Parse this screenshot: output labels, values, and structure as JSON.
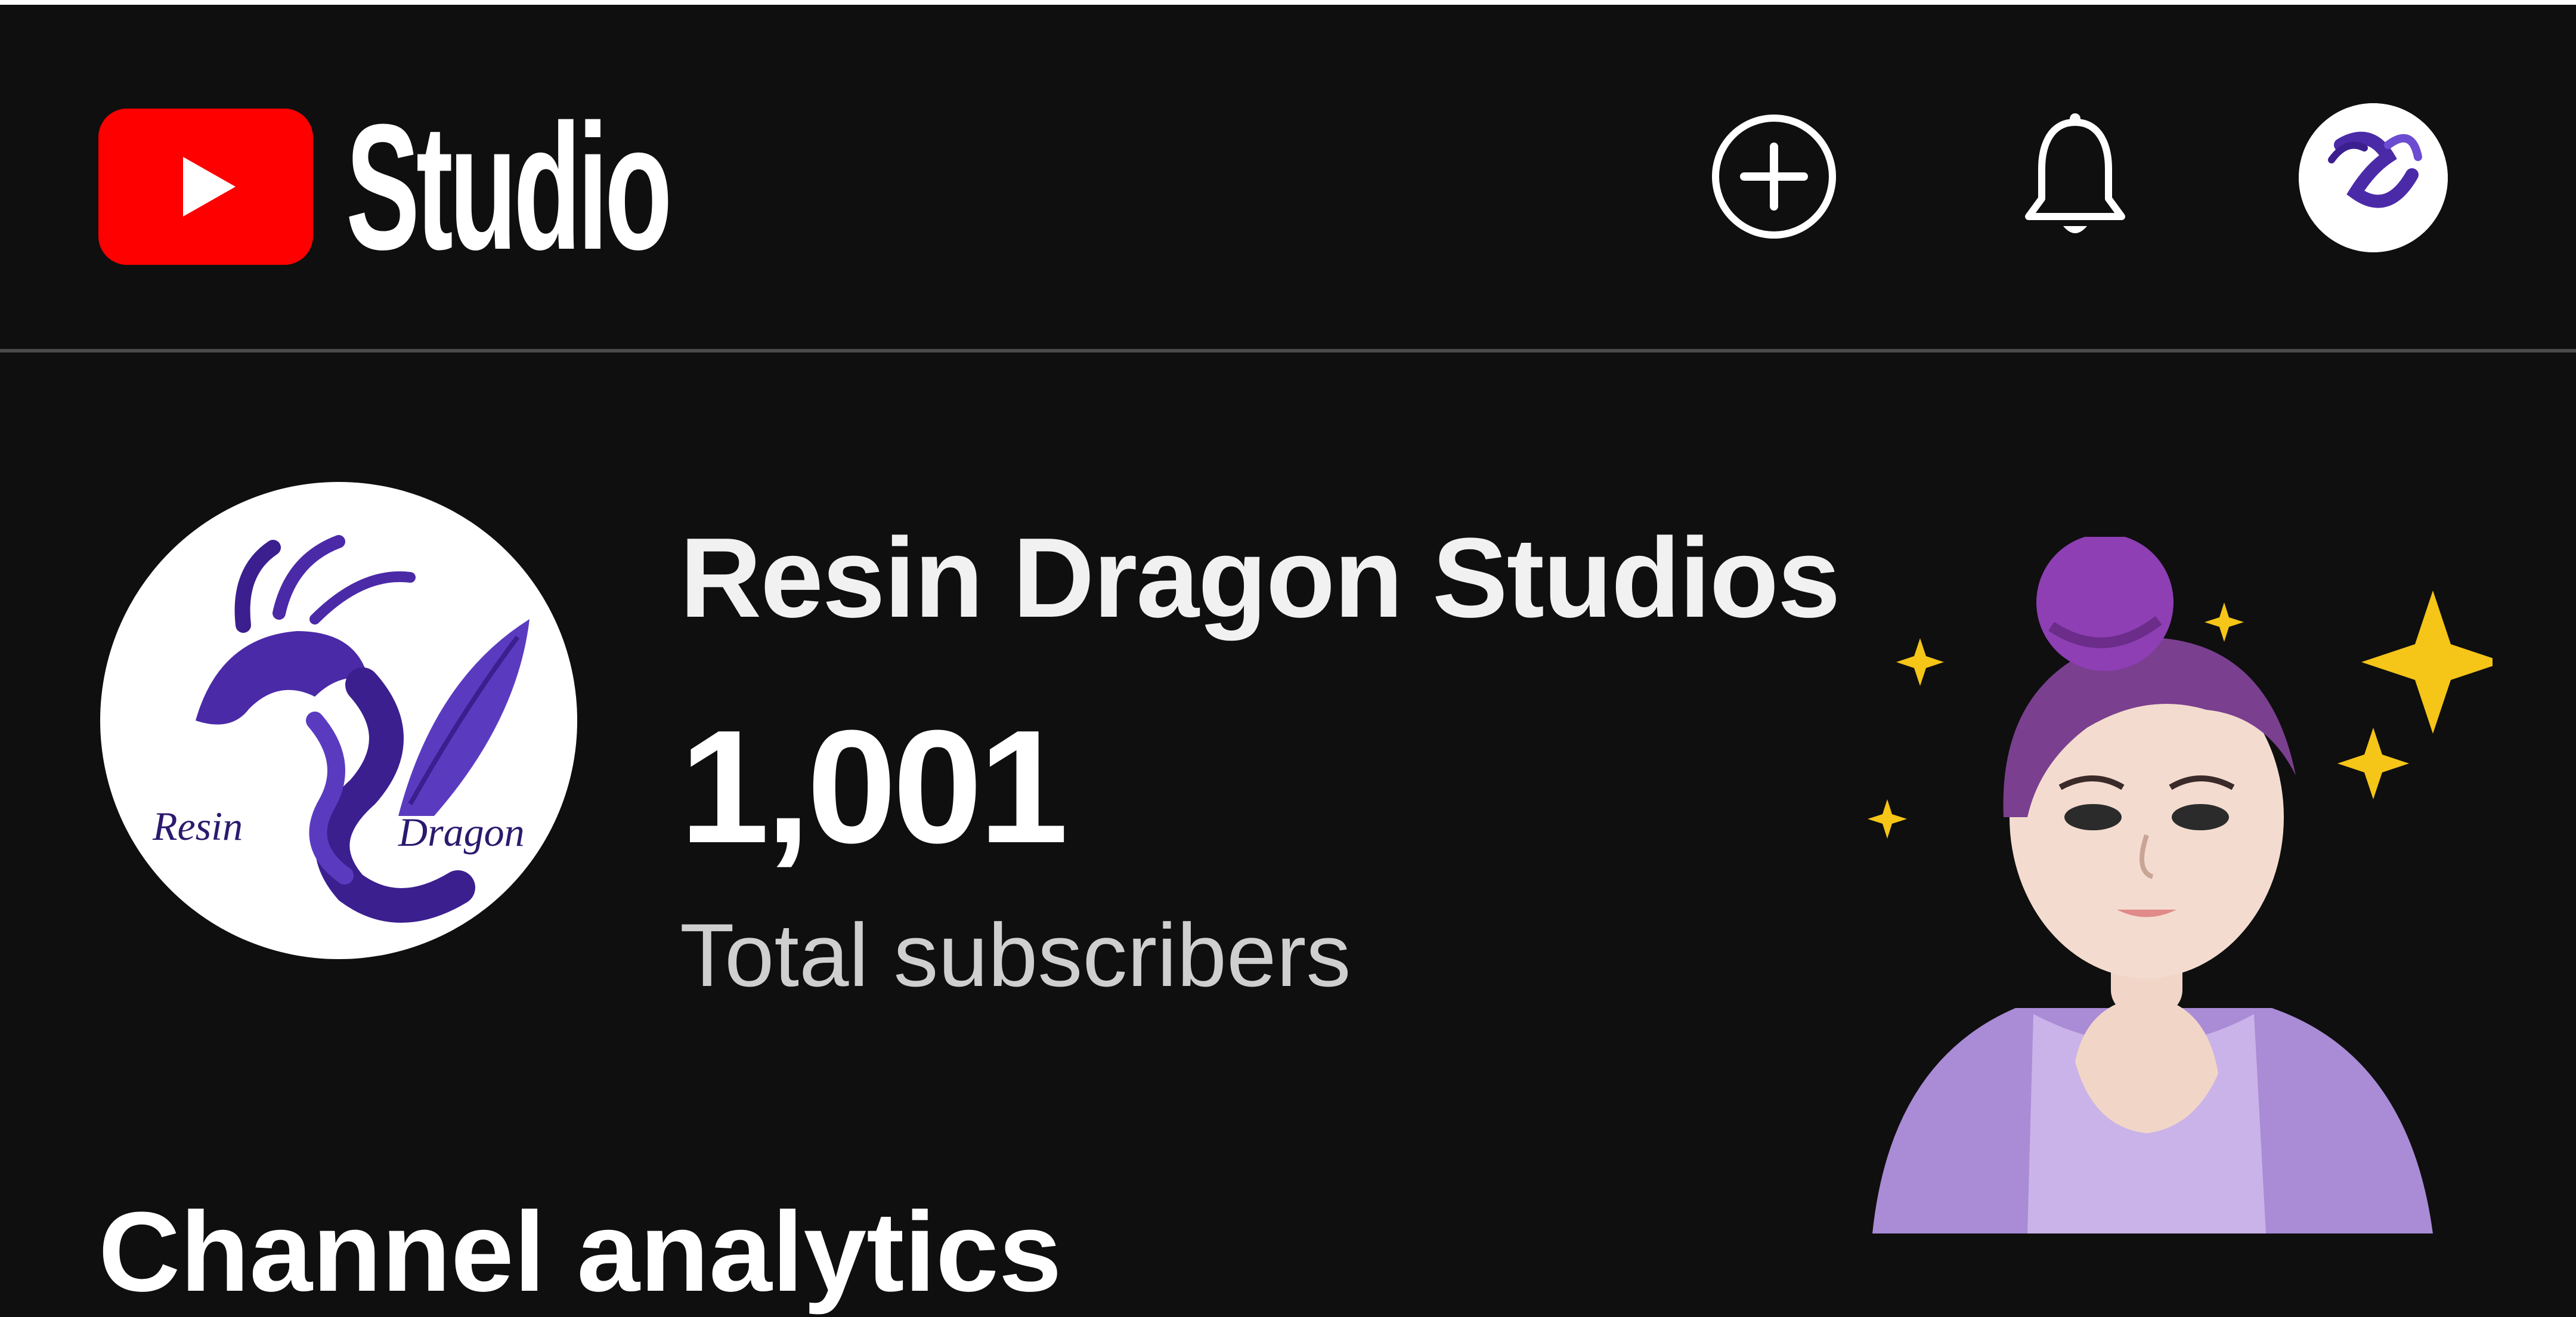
{
  "header": {
    "app_name": "Studio",
    "icons": {
      "logo": "youtube-play-icon",
      "create": "add-circle-icon",
      "notifications": "bell-icon",
      "account": "avatar"
    }
  },
  "channel": {
    "name": "Resin Dragon Studios",
    "subscriber_count": "1,001",
    "subscriber_label": "Total subscribers",
    "logo_text_left": "Resin",
    "logo_text_right": "Dragon"
  },
  "sections": {
    "analytics_heading": "Channel analytics"
  },
  "colors": {
    "background": "#0f0f0f",
    "brand_red": "#ff0000",
    "dragon_purple": "#4b2aa8",
    "sparkle_gold": "#f5c518"
  }
}
